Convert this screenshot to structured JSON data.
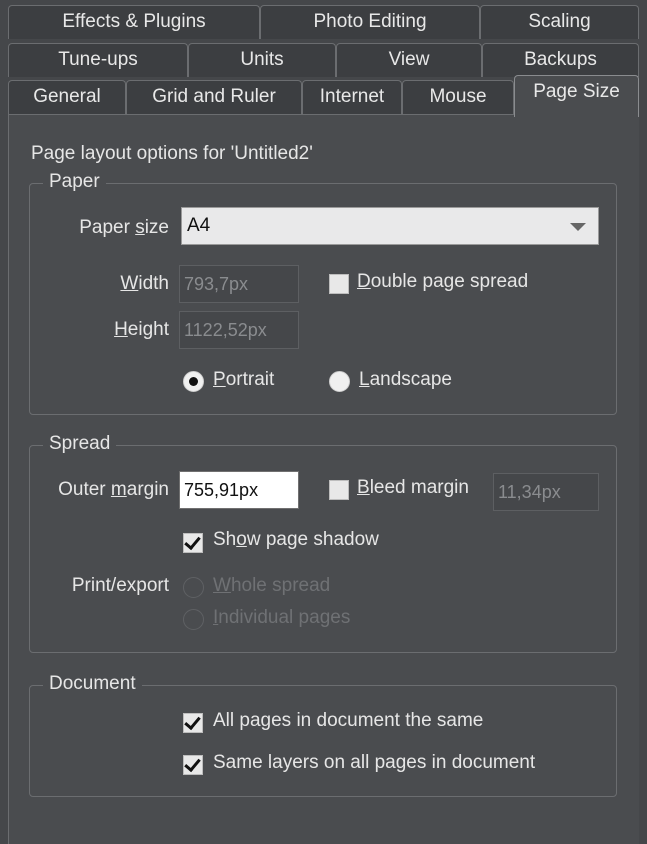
{
  "tabs": {
    "row1": [
      "Effects & Plugins",
      "Photo Editing",
      "Scaling"
    ],
    "row2": [
      "Tune-ups",
      "Units",
      "View",
      "Backups"
    ],
    "row3": [
      "General",
      "Grid and Ruler",
      "Internet",
      "Mouse",
      "Page Size"
    ],
    "active": "Page Size"
  },
  "heading": "Page layout options for 'Untitled2'",
  "paper": {
    "title": "Paper",
    "size_label_pre": "Paper ",
    "size_label_u": "s",
    "size_label_post": "ize",
    "size_value": "A4",
    "width_label_u": "W",
    "width_label_post": "idth",
    "width_value": "793,7px",
    "height_label_u": "H",
    "height_label_post": "eight",
    "height_value": "1122,52px",
    "double_spread_u": "D",
    "double_spread_post": "ouble page spread",
    "double_spread_checked": false,
    "portrait_u": "P",
    "portrait_post": "ortrait",
    "landscape_u": "L",
    "landscape_post": "andscape",
    "orientation": "portrait"
  },
  "spread": {
    "title": "Spread",
    "outer_label_pre": "Outer ",
    "outer_label_u": "m",
    "outer_label_post": "argin",
    "outer_value": "755,91px",
    "bleed_u": "B",
    "bleed_post": "leed margin",
    "bleed_checked": false,
    "bleed_value": "11,34px",
    "shadow_pre": "Sh",
    "shadow_u": "o",
    "shadow_post": "w page shadow",
    "shadow_checked": true,
    "print_label": "Print/export",
    "whole_u": "W",
    "whole_post": "hole spread",
    "individual_u": "I",
    "individual_post": "ndividual pages"
  },
  "document": {
    "title": "Document",
    "all_same": "All pages in document the same",
    "all_same_checked": true,
    "same_layers": "Same layers on all pages in document",
    "same_layers_checked": true
  }
}
